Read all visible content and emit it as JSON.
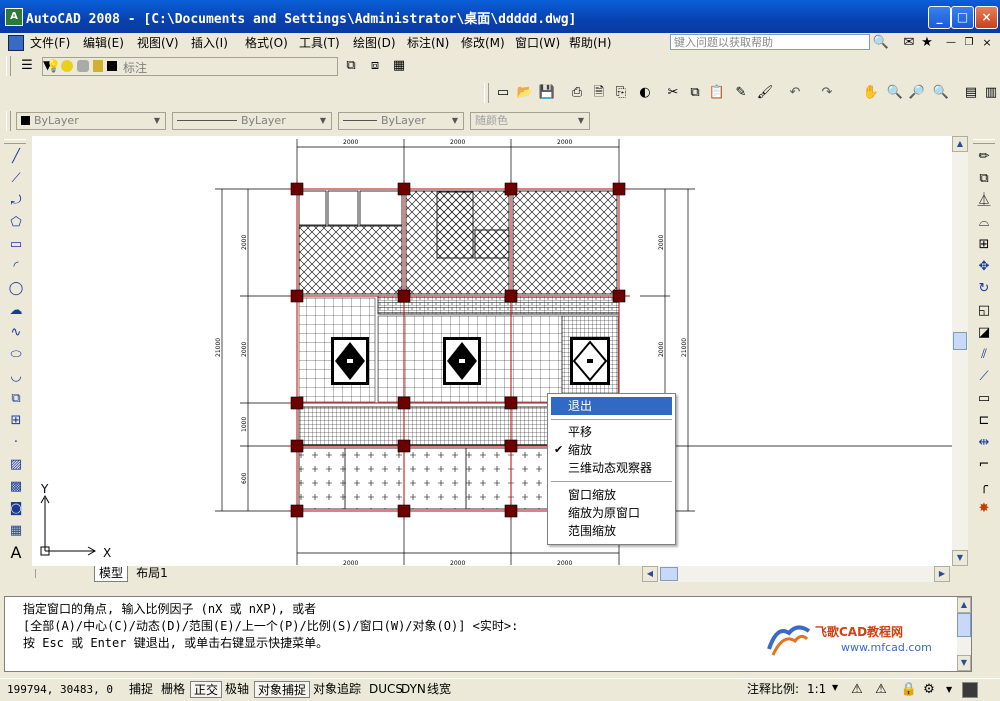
{
  "window": {
    "title": "AutoCAD 2008 - [C:\\Documents and Settings\\Administrator\\桌面\\ddddd.dwg]",
    "minimize": "_",
    "maximize": "□",
    "close": "×"
  },
  "menu": {
    "items": [
      "文件(F)",
      "编辑(E)",
      "视图(V)",
      "插入(I)",
      "格式(O)",
      "工具(T)",
      "绘图(D)",
      "标注(N)",
      "修改(M)",
      "窗口(W)",
      "帮助(H)"
    ],
    "help_search_placeholder": "键入问题以获取帮助"
  },
  "layer_toolbar": {
    "current_layer": "标注"
  },
  "properties_toolbar": {
    "color": "ByLayer",
    "linetype": "ByLayer",
    "lineweight": "ByLayer",
    "plotstyle": "随颜色"
  },
  "drawing": {
    "top_dims": [
      "2000",
      "2000",
      "2000"
    ],
    "bottom_dims": [
      "2000",
      "2000",
      "2000"
    ],
    "left_dims": [
      "2000",
      "2000",
      "1000",
      "600"
    ],
    "left_total": "21000",
    "right_dims": [
      "2000",
      "2000"
    ],
    "right_total": "21000",
    "ucs_x": "X",
    "ucs_y": "Y"
  },
  "tabs": {
    "model": "模型",
    "layout1": "布局1"
  },
  "context_menu": {
    "items": [
      "退出",
      "平移",
      "缩放",
      "三维动态观察器",
      "窗口缩放",
      "缩放为原窗口",
      "范围缩放"
    ],
    "checked_item": "缩放",
    "highlighted_item": "退出"
  },
  "command": {
    "lines": [
      "指定窗口的角点, 输入比例因子 (nX 或 nXP), 或者",
      "[全部(A)/中心(C)/动态(D)/范围(E)/上一个(P)/比例(S)/窗口(W)/对象(O)] <实时>:",
      "按 Esc 或 Enter 键退出, 或单击右键显示快捷菜单。"
    ]
  },
  "watermark": {
    "line1": "飞歌CAD教程网",
    "line2": "www.mfcad.com"
  },
  "status": {
    "coords": "199794, 30483, 0",
    "toggles": [
      "捕捉",
      "栅格",
      "正交",
      "极轴",
      "对象捕捉",
      "对象追踪",
      "DUCS",
      "DYN",
      "线宽"
    ],
    "active_toggles": [
      "正交",
      "对象捕捉"
    ],
    "annotation_scale_label": "注释比例:",
    "annotation_scale": "1:1"
  },
  "colors": {
    "title_blue": "#0a4fc8",
    "highlight": "#316ac5",
    "column_red": "#8b0000",
    "dim_red": "#c00000"
  }
}
